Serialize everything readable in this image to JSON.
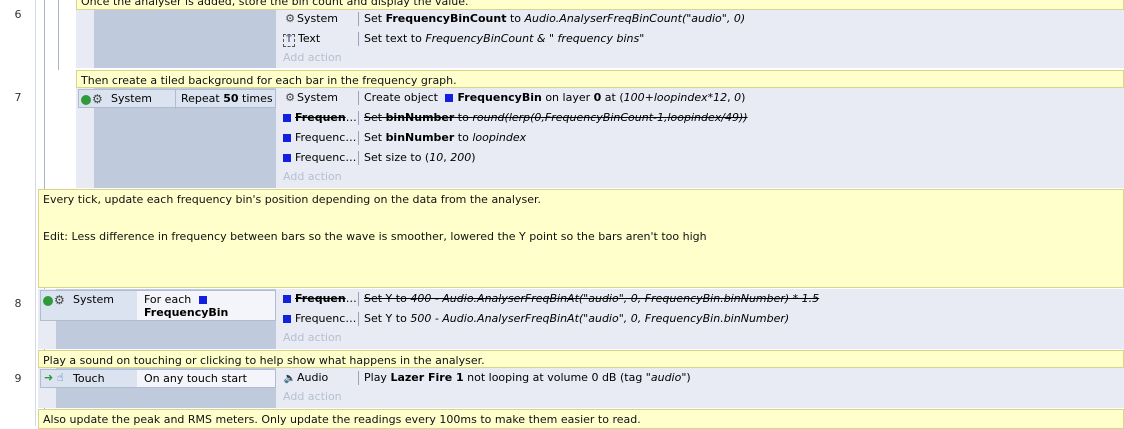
{
  "events": {
    "e6": {
      "row_number": "6",
      "comment": "Once the analyser is added, store the bin count and display the value.",
      "actions": [
        {
          "icon": "gear-icon",
          "object": "System",
          "text_parts": [
            {
              "t": "Set "
            },
            {
              "t": "FrequencyBinCount",
              "b": true
            },
            {
              "t": " to "
            },
            {
              "t": "Audio.AnalyserFreqBinCount(\"audio\", 0)",
              "i": true
            }
          ]
        },
        {
          "icon": "text-object-icon",
          "object": "Text",
          "text_parts": [
            {
              "t": "Set text to "
            },
            {
              "t": "FrequencyBinCount & \" frequency bins\"",
              "i": true
            }
          ]
        }
      ],
      "add_action": "Add action"
    },
    "e7": {
      "row_number": "7",
      "comment": "Then create a tiled background for each bar in the frequency graph.",
      "condition": {
        "object": "System",
        "text_prefix": "Repeat ",
        "text_bold": "50",
        "text_suffix": " times"
      },
      "actions": [
        {
          "icon": "gear-icon",
          "object": "System",
          "strike": false,
          "text_parts": [
            {
              "t": "Create object "
            },
            {
              "sq": true
            },
            {
              "t": "FrequencyBin",
              "b": true
            },
            {
              "t": " on layer "
            },
            {
              "t": "0",
              "b": true
            },
            {
              "t": " at ("
            },
            {
              "t": "100+loopindex*12",
              "i": true
            },
            {
              "t": ", "
            },
            {
              "t": "0",
              "i": true
            },
            {
              "t": ")"
            }
          ]
        },
        {
          "icon": "frequencybin-icon",
          "object": "FrequencyBin",
          "strike": true,
          "text_parts": [
            {
              "t": "Set "
            },
            {
              "t": "binNumber",
              "b": true
            },
            {
              "t": " to "
            },
            {
              "t": "round(lerp(0,FrequencyBinCount-1,loopindex/49))",
              "i": true
            }
          ]
        },
        {
          "icon": "frequencybin-icon",
          "object": "FrequencyBin",
          "strike": false,
          "text_parts": [
            {
              "t": "Set "
            },
            {
              "t": "binNumber",
              "b": true
            },
            {
              "t": " to "
            },
            {
              "t": "loopindex",
              "i": true
            }
          ]
        },
        {
          "icon": "frequencybin-icon",
          "object": "FrequencyBin",
          "strike": false,
          "text_parts": [
            {
              "t": "Set size to ("
            },
            {
              "t": "10",
              "i": true
            },
            {
              "t": ", "
            },
            {
              "t": "200",
              "i": true
            },
            {
              "t": ")"
            }
          ]
        }
      ],
      "add_action": "Add action"
    },
    "e8": {
      "row_number": "8",
      "comment_line1": "Every tick, update each frequency bin's position depending on the data from the analyser.",
      "comment_line2": "Edit: Less difference in frequency between bars so the wave is smoother, lowered the Y point so the bars aren't too high",
      "condition": {
        "object": "System",
        "text_line1": "For each",
        "text_line2": "FrequencyBin"
      },
      "actions": [
        {
          "icon": "frequencybin-icon",
          "object": "FrequencyBin",
          "strike": true,
          "text_parts": [
            {
              "t": "Set Y to "
            },
            {
              "t": "400 - Audio.AnalyserFreqBinAt(\"audio\", 0, FrequencyBin.binNumber) * 1.5",
              "i": true
            }
          ]
        },
        {
          "icon": "frequencybin-icon",
          "object": "FrequencyBin",
          "strike": false,
          "text_parts": [
            {
              "t": "Set Y to "
            },
            {
              "t": "500 - Audio.AnalyserFreqBinAt(\"audio\", 0, FrequencyBin.binNumber)",
              "i": true
            }
          ]
        }
      ],
      "add_action": "Add action"
    },
    "e9": {
      "row_number": "9",
      "comment": "Play a sound on touching or clicking to help show what happens in the analyser.",
      "condition": {
        "object": "Touch",
        "text": "On any touch start"
      },
      "actions": [
        {
          "icon": "audio-icon",
          "object": "Audio",
          "strike": false,
          "text_parts": [
            {
              "t": "Play "
            },
            {
              "t": "Lazer Fire 1",
              "b": true
            },
            {
              "t": " not looping at volume 0 dB (tag "
            },
            {
              "t": "\"audio\"",
              "i": true
            },
            {
              "t": ")"
            }
          ]
        }
      ],
      "add_action": "Add action"
    },
    "e10": {
      "comment": "Also update the peak and RMS meters. Only update the readings every 100ms to make them easier to read."
    }
  },
  "colors": {
    "comment_bg": "#ffffcc",
    "event_bg": "#e8ebf4",
    "condition_bg": "#bfcadd",
    "object_square": "#1420e0"
  }
}
